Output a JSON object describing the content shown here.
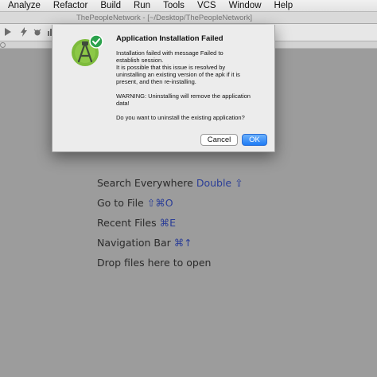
{
  "menu": [
    "Analyze",
    "Refactor",
    "Build",
    "Run",
    "Tools",
    "VCS",
    "Window",
    "Help"
  ],
  "window_title": "ThePeopleNetwork - [~/Desktop/ThePeopleNetwork]",
  "dialog": {
    "title": "Application Installation Failed",
    "message_lines": [
      "Installation failed with message Failed to",
      "establish session.",
      "It is possible that this issue is resolved by",
      "uninstalling an existing version of the apk if it is",
      "present, and then re-installing."
    ],
    "warning_lines": [
      "WARNING: Uninstalling will remove the application",
      "data!"
    ],
    "question": "Do you want to uninstall the existing application?",
    "cancel_label": "Cancel",
    "ok_label": "OK",
    "icon": "android-studio-icon"
  },
  "hints": [
    {
      "label": "Search Everywhere",
      "key": "Double ⇧"
    },
    {
      "label": "Go to File",
      "key": "⇧⌘O"
    },
    {
      "label": "Recent Files",
      "key": "⌘E"
    },
    {
      "label": "Navigation Bar",
      "key": "⌘↑"
    },
    {
      "label": "Drop files here to open",
      "key": ""
    }
  ],
  "colors": {
    "accent": "#1f7cf5",
    "hint_key": "#2a3d97",
    "editor_bg": "#9c9c9c"
  }
}
